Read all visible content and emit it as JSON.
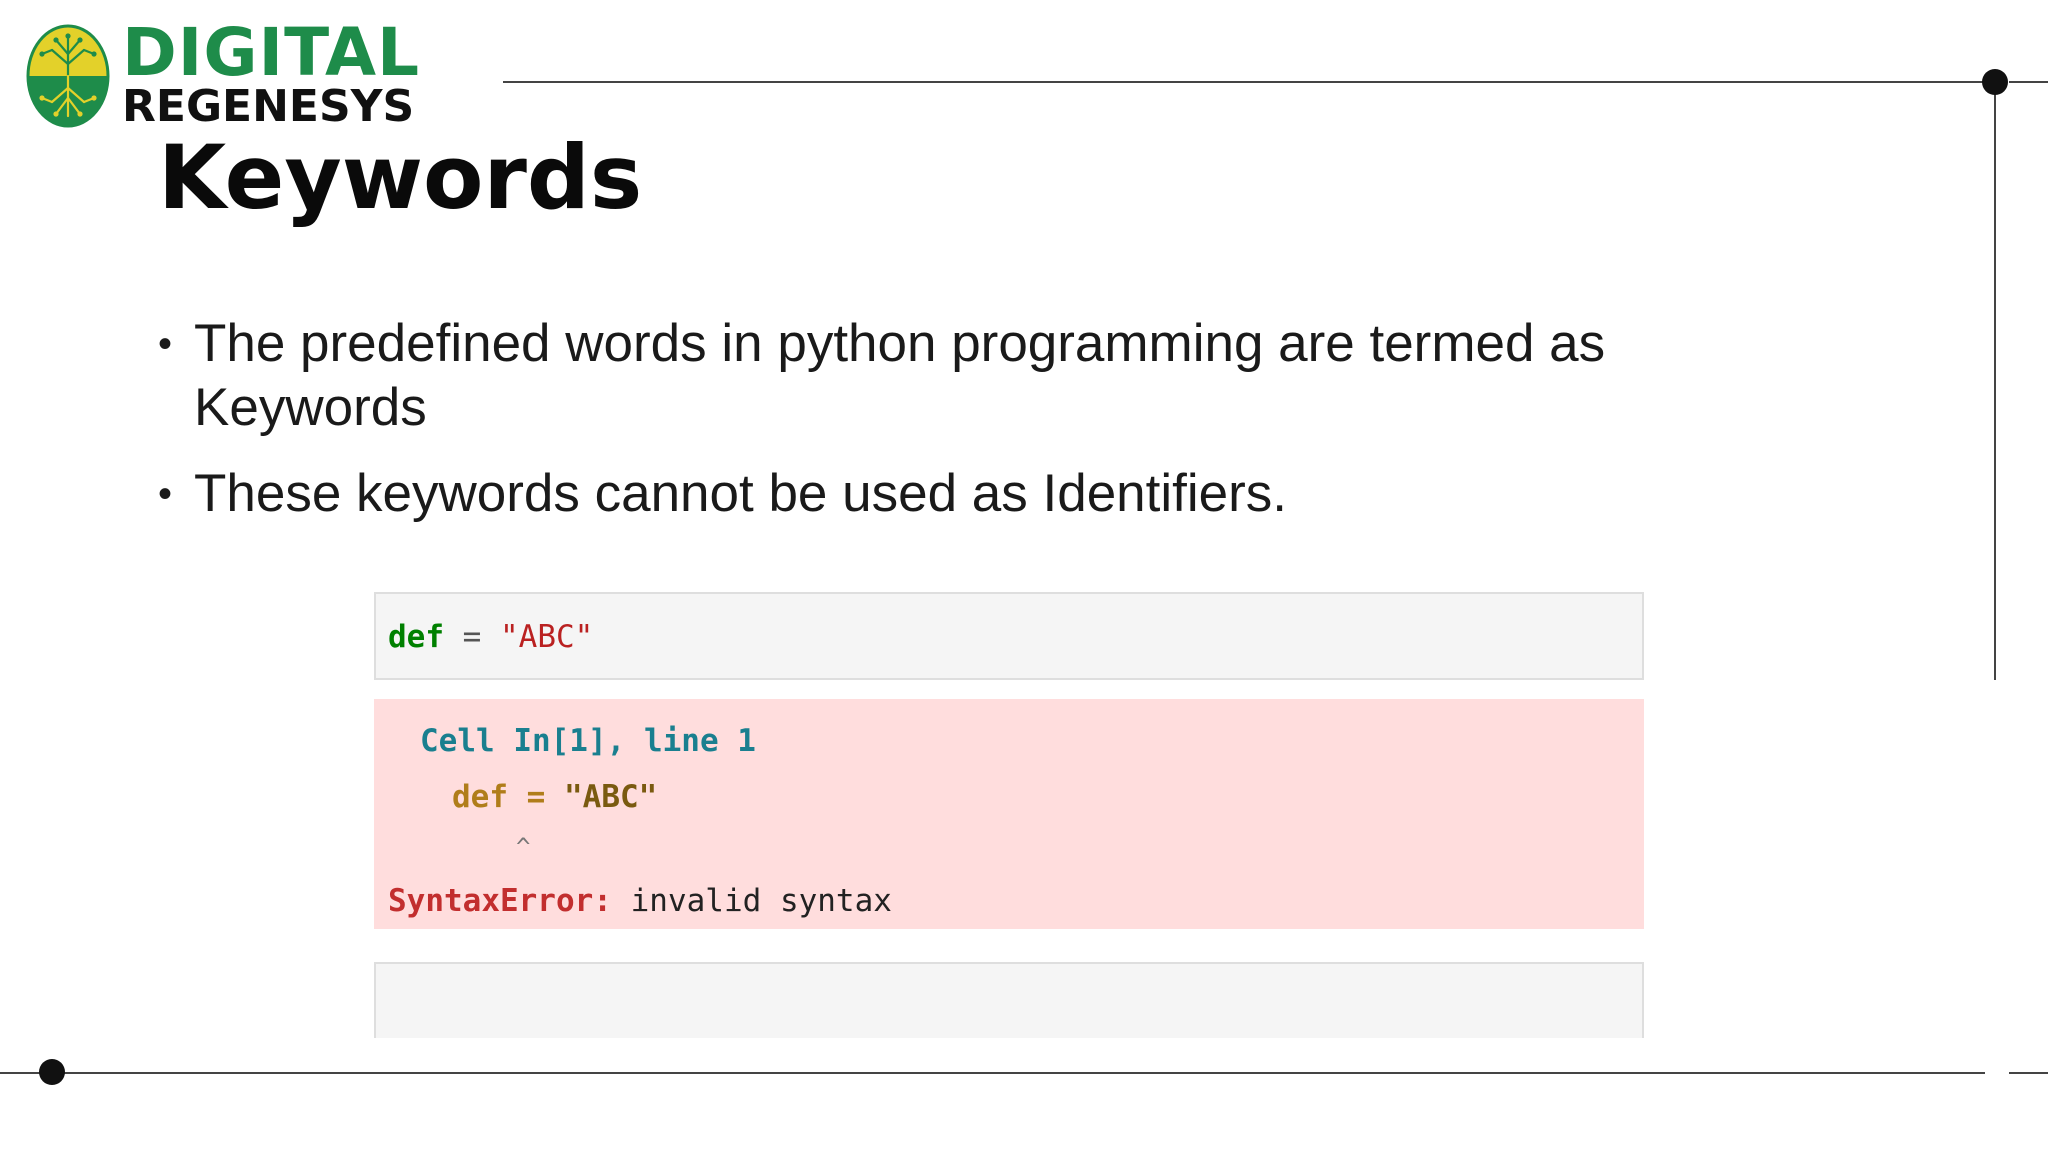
{
  "logo": {
    "line1": "DIGITAL",
    "line2": "REGENESYS",
    "colors": {
      "green": "#1e8c4a",
      "yellow": "#e3d12a",
      "dark": "#111111"
    }
  },
  "slide": {
    "title": "Keywords",
    "bullets": [
      "The predefined words in python programming are termed as Keywords",
      "These keywords cannot be used as Identifiers."
    ],
    "bullet_glyph": "•"
  },
  "notebook": {
    "input_cell": {
      "keyword": "def",
      "operator": " = ",
      "string": "\"ABC\""
    },
    "error_cell": {
      "cell_ref": "Cell In[1], line 1",
      "code_keyword": "def",
      "code_operator": " = ",
      "code_string": "\"ABC\"",
      "caret": "^",
      "error_name": "SyntaxError:",
      "error_message": " invalid syntax",
      "background": "#ffdddd"
    }
  },
  "colors": {
    "keyword_green": "#008000",
    "string_red": "#ba2121",
    "error_red": "#c22e2e",
    "line_gray": "#444444"
  }
}
